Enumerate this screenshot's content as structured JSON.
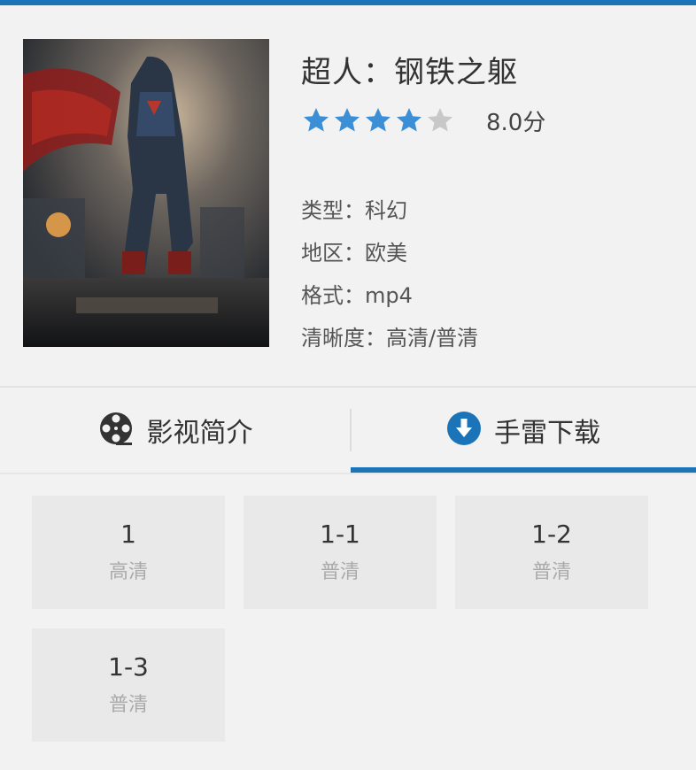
{
  "colors": {
    "accent": "#1b74b8",
    "star_on": "#3a8fd6",
    "star_off": "#c8c8c8"
  },
  "movie": {
    "title": "超人：钢铁之躯",
    "rating": {
      "stars_filled": 4,
      "stars_total": 5,
      "score_text": "8.0分"
    },
    "meta": [
      "类型：科幻",
      "地区：欧美",
      "格式：mp4",
      "清晰度：高清/普清"
    ]
  },
  "tabs": [
    {
      "label": "影视简介",
      "icon": "film-reel-icon",
      "selected": false
    },
    {
      "label": "手雷下载",
      "icon": "download-circle-icon",
      "selected": true
    }
  ],
  "episodes": [
    {
      "number": "1",
      "quality": "高清"
    },
    {
      "number": "1-1",
      "quality": "普清"
    },
    {
      "number": "1-2",
      "quality": "普清"
    },
    {
      "number": "1-3",
      "quality": "普清"
    }
  ]
}
